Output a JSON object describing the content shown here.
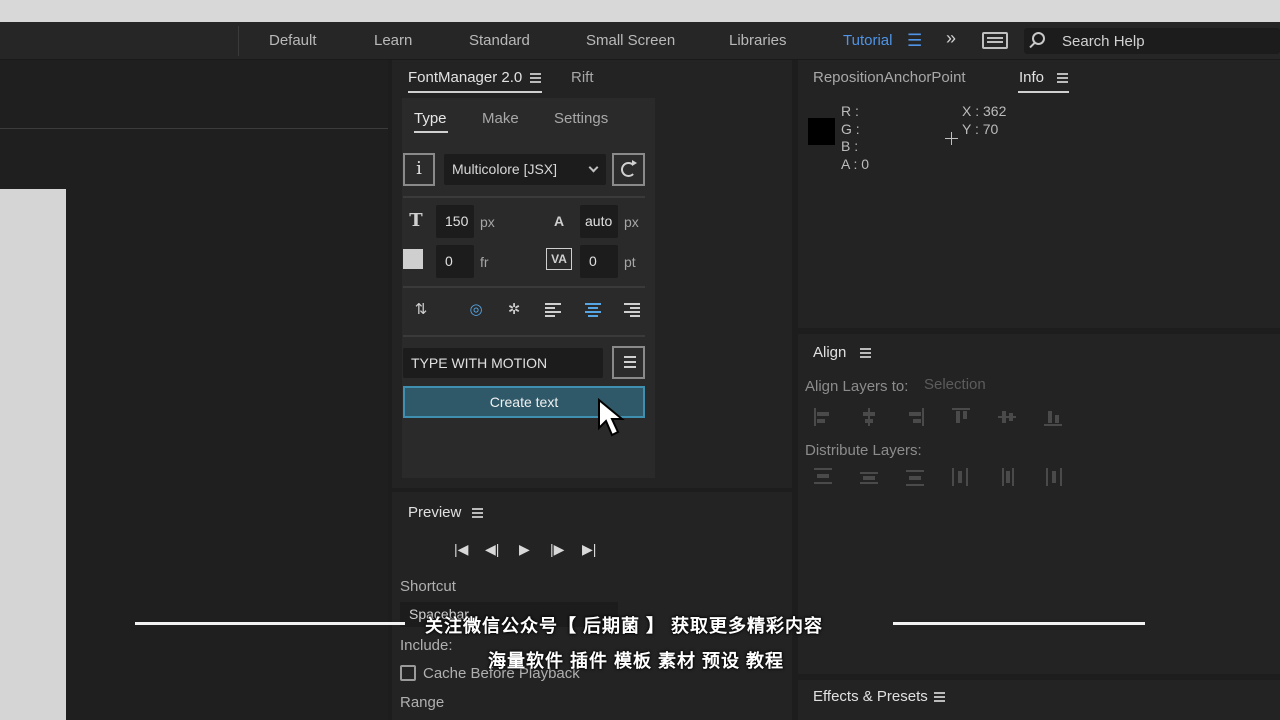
{
  "workspace": {
    "items": [
      "Default",
      "Learn",
      "Standard",
      "Small Screen",
      "Libraries",
      "Tutorial"
    ],
    "active": "Tutorial",
    "search_placeholder": "Search Help",
    "accent_color": "#4f94e6"
  },
  "fontmanager": {
    "tabs": [
      "FontManager 2.0",
      "Rift"
    ],
    "subtabs": [
      "Type",
      "Make",
      "Settings"
    ],
    "info_label": "i",
    "font_select": "Multicolore [JSX]",
    "font_size": "150",
    "font_size_unit": "px",
    "leading": "auto",
    "leading_unit": "px",
    "frames": "0",
    "frames_unit": "fr",
    "tracking": "0",
    "tracking_unit": "pt",
    "text_value": "TYPE WITH MOTION",
    "create_label": "Create text"
  },
  "preview": {
    "title": "Preview",
    "shortcut_label": "Shortcut",
    "shortcut_value": "Spacebar",
    "include_label": "Include:",
    "cache_label": "Cache Before Playback",
    "range_label": "Range"
  },
  "info": {
    "tabs": [
      "RepositionAnchorPoint",
      "Info"
    ],
    "r_label": "R :",
    "g_label": "G :",
    "b_label": "B :",
    "a_label": "A :  0",
    "x_label": "X : 362",
    "y_label": "Y : 70"
  },
  "align": {
    "title": "Align",
    "align_layers_label": "Align Layers to:",
    "align_layers_value": "Selection",
    "distribute_label": "Distribute Layers:"
  },
  "effects": {
    "title": "Effects & Presets"
  },
  "overlay": {
    "line1": "关注微信公众号【 后期菌 】 获取更多精彩内容",
    "line2": "海量软件 插件 模板 素材 预设 教程"
  }
}
